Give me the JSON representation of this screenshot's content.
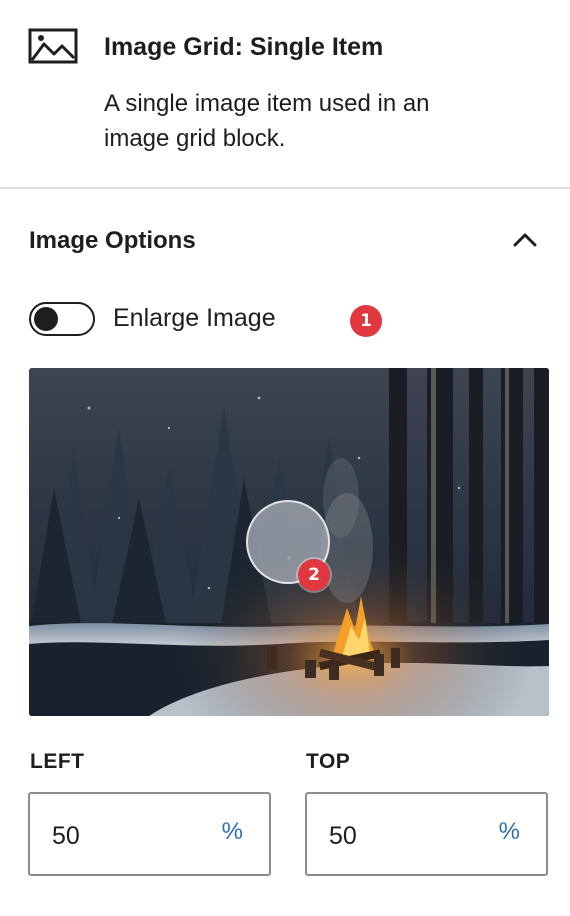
{
  "block": {
    "title": "Image Grid: Single Item",
    "description": "A single image item used in an image grid block.",
    "icon": "image-icon"
  },
  "panel": {
    "title": "Image Options",
    "expanded": true,
    "toggle_icon": "chevron-up-icon"
  },
  "enlarge": {
    "label": "Enlarge Image",
    "checked": false
  },
  "annotations": {
    "first": "1",
    "second": "2",
    "color": "#e0383e"
  },
  "focal_point": {
    "scene": "snowy night forest with campfire",
    "handle_icon": "focal-point-handle"
  },
  "position": {
    "left_label": "LEFT",
    "left_value": "50",
    "left_unit": "%",
    "top_label": "TOP",
    "top_value": "50",
    "top_unit": "%",
    "unit_color": "#2f6fb5"
  }
}
